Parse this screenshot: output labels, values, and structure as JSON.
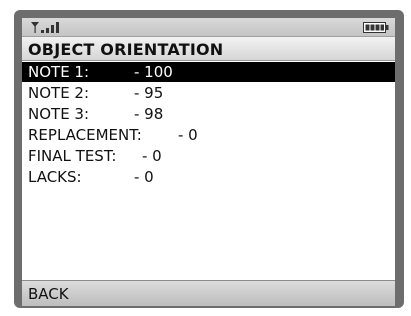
{
  "status_bar": {
    "signal_icon": "signal-strength-icon",
    "battery_icon": "battery-icon"
  },
  "title": "OBJECT ORIENTATION",
  "items": [
    {
      "label": "NOTE 1:",
      "value": "- 100",
      "selected": true
    },
    {
      "label": "NOTE 2:",
      "value": "- 95",
      "selected": false
    },
    {
      "label": "NOTE 3:",
      "value": "- 98",
      "selected": false
    },
    {
      "label": "REPLACEMENT:",
      "value": "- 0",
      "selected": false
    },
    {
      "label": "FINAL TEST:",
      "value": "- 0",
      "selected": false
    },
    {
      "label": "LACKS:",
      "value": "- 0",
      "selected": false
    }
  ],
  "softkeys": {
    "left": "BACK"
  },
  "colors": {
    "selection_bg": "#000000",
    "selection_fg": "#ffffff",
    "bar_gray": "#c4c4c4"
  }
}
